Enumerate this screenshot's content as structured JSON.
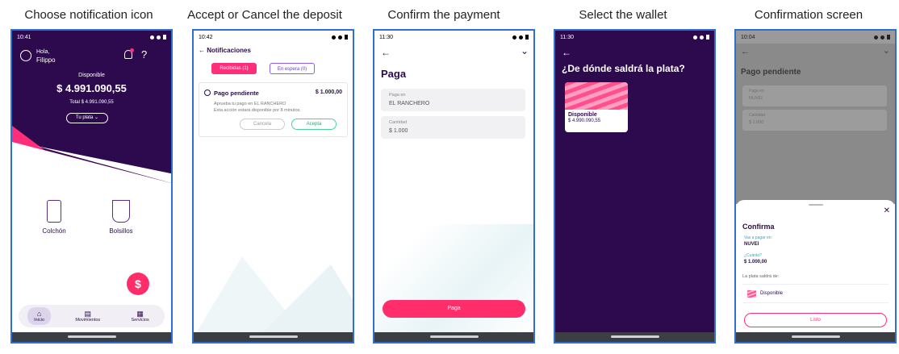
{
  "captions": [
    "Choose notification icon",
    "Accept or Cancel the deposit",
    "Confirm the payment",
    "Select the wallet",
    "Confirmation screen"
  ],
  "screen1": {
    "time": "10:41",
    "greeting": "Hola,",
    "name": "Filippo",
    "available_label": "Disponible",
    "balance": "$ 4.991.090,55",
    "total": "Total $ 4.991.090,55",
    "plata_button": "Tu plata",
    "tiles": [
      "Colchón",
      "Bolsillos"
    ],
    "fab": "$",
    "nav": [
      "Inicio",
      "Movimientos",
      "Servicios"
    ]
  },
  "screen2": {
    "time": "10:42",
    "title": "Notificaciones",
    "tabs": [
      "Recibidas (1)",
      "En espera (0)"
    ],
    "card_title": "Pago pendiente",
    "card_amount": "$ 1.000,00",
    "card_desc1": "Aprueba tu pago en EL RANCHERO",
    "card_desc2": "Esta acción estará disponible por 8 minutos.",
    "cancel": "Cancela",
    "accept": "Acepta"
  },
  "screen3": {
    "time": "11:30",
    "title": "Paga",
    "field1_label": "Paga en",
    "field1_value": "EL RANCHERO",
    "field2_label": "Cantidad",
    "field2_value": "$ 1.000",
    "button": "Paga"
  },
  "screen4": {
    "time": "11:30",
    "question": "¿De dónde saldrá la plata?",
    "wallet_name": "Disponible",
    "wallet_amount": "$ 4.990.090,55"
  },
  "screen5": {
    "time": "10:04",
    "bg_title": "Pago pendiente",
    "bg_field1_label": "Paga en",
    "bg_field1_value": "NUVEI",
    "bg_field2_label": "Cantidad",
    "bg_field2_value": "$ 1.000",
    "sheet_title": "Confirma",
    "pay_label": "Vas a pagar en:",
    "pay_value": "NUVEI",
    "amount_label": "¿Cuánto?",
    "amount_value": "$ 1.000,00",
    "source_label": "La plata saldrá de:",
    "source_value": "Disponible",
    "button": "Listo"
  }
}
